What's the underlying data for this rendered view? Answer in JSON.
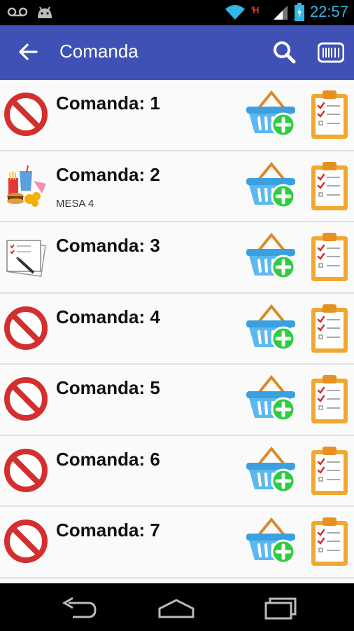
{
  "status_bar": {
    "time": "22:57"
  },
  "app_bar": {
    "title": "Comanda"
  },
  "rows": [
    {
      "label": "Comanda: 1",
      "sub": "",
      "status": "blocked"
    },
    {
      "label": "Comanda: 2",
      "sub": "MESA 4",
      "status": "food"
    },
    {
      "label": "Comanda: 3",
      "sub": "",
      "status": "order-note"
    },
    {
      "label": "Comanda: 4",
      "sub": "",
      "status": "blocked"
    },
    {
      "label": "Comanda: 5",
      "sub": "",
      "status": "blocked"
    },
    {
      "label": "Comanda: 6",
      "sub": "",
      "status": "blocked"
    },
    {
      "label": "Comanda: 7",
      "sub": "",
      "status": "blocked"
    }
  ],
  "colors": {
    "app_bar": "#3f51b5",
    "time": "#33b5e5",
    "blocked_red": "#d32f2f",
    "add_green": "#2ecc40",
    "basket_blue": "#3aa0e0",
    "clipboard_orange": "#f0a830"
  }
}
